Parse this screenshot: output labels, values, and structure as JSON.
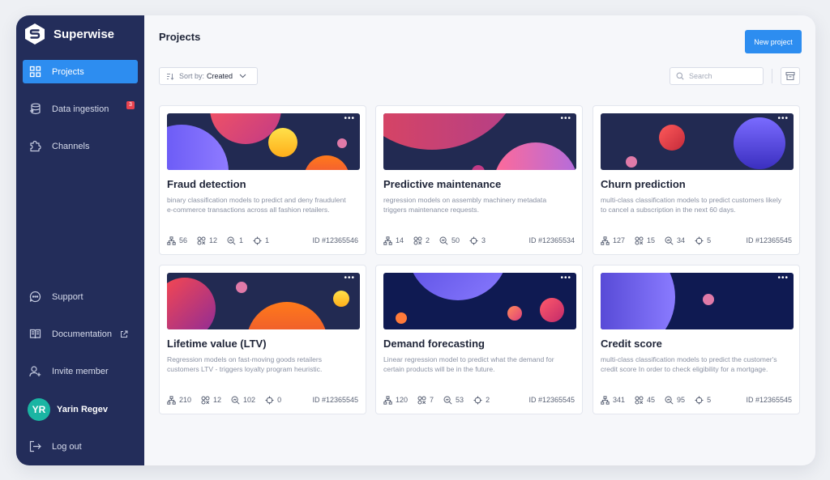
{
  "app": {
    "brand": "Superwise"
  },
  "sidebar": {
    "items": [
      {
        "label": "Projects",
        "icon": "grid-icon",
        "active": true
      },
      {
        "label": "Data ingestion",
        "icon": "database-icon",
        "badge": "3"
      },
      {
        "label": "Channels",
        "icon": "puzzle-icon"
      }
    ],
    "bottom": [
      {
        "label": "Support",
        "icon": "chat-icon"
      },
      {
        "label": "Documentation",
        "icon": "book-icon"
      },
      {
        "label": "Invite member",
        "icon": "user-plus-icon"
      }
    ],
    "user": {
      "initials": "YR",
      "name": "Yarin Regev"
    },
    "logout": "Log out"
  },
  "header": {
    "title": "Projects",
    "new_project": "New project",
    "sort_label": "Sort by:",
    "sort_value": "Created",
    "search_placeholder": "Search"
  },
  "colors": {
    "accent": "#2d8df0",
    "sidebar": "#232d5a",
    "badge": "#e8434f",
    "avatar": "#1ab5a3"
  },
  "projects": [
    {
      "title": "Fraud detection",
      "description": "binary classification models to predict and deny fraudulent e-commerce transactions across all fashion retailers.",
      "stats": [
        "56",
        "12",
        "1",
        "1"
      ],
      "id": "ID #12365546"
    },
    {
      "title": "Predictive maintenance",
      "description": "regression models on assembly machinery metadata triggers maintenance requests.",
      "stats": [
        "14",
        "2",
        "50",
        "3"
      ],
      "id": "ID #12365534"
    },
    {
      "title": "Churn prediction",
      "description": "multi-class classification models to predict customers likely to cancel a subscription in the next 60 days.",
      "stats": [
        "127",
        "15",
        "34",
        "5"
      ],
      "id": "ID #12365545"
    },
    {
      "title": "Lifetime value (LTV)",
      "description": "Regression models on fast-moving goods retailers customers LTV - triggers loyalty program heuristic.",
      "stats": [
        "210",
        "12",
        "102",
        "0"
      ],
      "id": "ID #12365545"
    },
    {
      "title": "Demand forecasting",
      "description": "Linear regression model to predict what the demand for certain products will be in the future.",
      "stats": [
        "120",
        "7",
        "53",
        "2"
      ],
      "id": "ID #12365545"
    },
    {
      "title": "Credit score",
      "description": " multi-class classification models to predict the customer's credit score In order to check eligibility for a mortgage.",
      "stats": [
        "341",
        "45",
        "95",
        "5"
      ],
      "id": "ID #12365545"
    }
  ]
}
